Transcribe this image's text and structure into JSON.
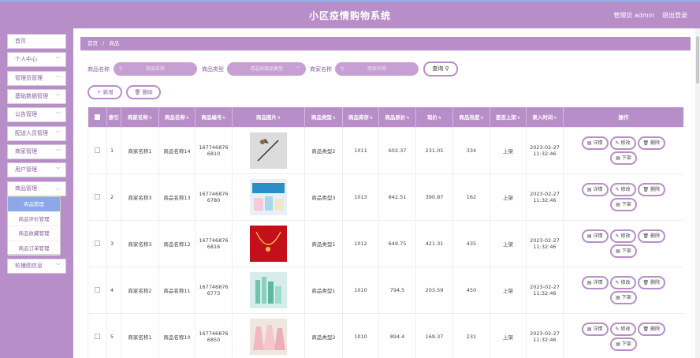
{
  "header": {
    "title": "小区疫情购物系统",
    "admin_text": "管理员 admin",
    "logout_label": "退出登录"
  },
  "sidebar": {
    "items": [
      {
        "label": "首页",
        "has_chevron": false
      },
      {
        "label": "个人中心",
        "has_chevron": true
      },
      {
        "label": "管理员管理",
        "has_chevron": true
      },
      {
        "label": "基础数据管理",
        "has_chevron": true
      },
      {
        "label": "公告管理",
        "has_chevron": true
      },
      {
        "label": "配送人员管理",
        "has_chevron": true
      },
      {
        "label": "商家管理",
        "has_chevron": true
      },
      {
        "label": "用户管理",
        "has_chevron": true
      },
      {
        "label": "商品管理",
        "has_chevron": true
      },
      {
        "label": "轮播图信息",
        "has_chevron": true
      }
    ],
    "submenu": [
      {
        "label": "商品管理",
        "active": true
      },
      {
        "label": "商品评价管理",
        "active": false
      },
      {
        "label": "商品收藏管理",
        "active": false
      },
      {
        "label": "商品订单管理",
        "active": false
      }
    ]
  },
  "breadcrumb": {
    "home": "首页",
    "separator": "/",
    "current": "商品"
  },
  "filters": {
    "product_name_label": "商品名称",
    "product_name_placeholder": "商品名称",
    "product_type_label": "商品类型",
    "product_type_placeholder": "请选择商品类型",
    "merchant_name_label": "商家名称",
    "merchant_name_placeholder": "商家名称",
    "query_label": "查询"
  },
  "actions": {
    "add_label": "新增",
    "delete_label": "删除"
  },
  "table": {
    "columns": [
      "索引",
      "商家名称",
      "商品名称",
      "商品编号",
      "商品图片",
      "商品类型",
      "商品库存",
      "商品原价",
      "现价",
      "商品热度",
      "是否上架",
      "录入时间",
      "操作"
    ],
    "rows": [
      {
        "index": "1",
        "merchant": "商家名称1",
        "name": "商品名称14",
        "code": "167746876 6810",
        "image": "hairpin",
        "type": "商品类型2",
        "stock": "1011",
        "original_price": "602.37",
        "price": "231.05",
        "heat": "334",
        "on_shelf": "上架",
        "time": "2023-02-27 11:32:46"
      },
      {
        "index": "2",
        "merchant": "商家名称3",
        "name": "商品名称13",
        "code": "167746876 6780",
        "image": "cosmetics-box",
        "type": "商品类型3",
        "stock": "1013",
        "original_price": "842.51",
        "price": "390.87",
        "heat": "162",
        "on_shelf": "上架",
        "time": "2023-02-27 11:32:46"
      },
      {
        "index": "3",
        "merchant": "商家名称3",
        "name": "商品名称12",
        "code": "167746876 6816",
        "image": "gold-necklace",
        "type": "商品类型1",
        "stock": "1012",
        "original_price": "649.75",
        "price": "421.31",
        "heat": "435",
        "on_shelf": "上架",
        "time": "2023-02-27 11:32:46"
      },
      {
        "index": "4",
        "merchant": "商家名称2",
        "name": "商品名称11",
        "code": "167746876 6773",
        "image": "skincare-bottles",
        "type": "商品类型1",
        "stock": "1010",
        "original_price": "794.5",
        "price": "203.59",
        "heat": "450",
        "on_shelf": "上架",
        "time": "2023-02-27 11:32:46"
      },
      {
        "index": "5",
        "merchant": "商家名称1",
        "name": "商品名称10",
        "code": "167746876 6850",
        "image": "dresses",
        "type": "商品类型2",
        "stock": "1010",
        "original_price": "894.4",
        "price": "169.37",
        "heat": "231",
        "on_shelf": "上架",
        "time": "2023-02-27 11:32:46"
      }
    ],
    "row_actions": {
      "detail_label": "详情",
      "edit_label": "修改",
      "delete_label": "删除",
      "offshelf_label": "下架"
    }
  },
  "colors": {
    "primary": "#b88ec8",
    "active_submenu": "#8da8e8"
  }
}
